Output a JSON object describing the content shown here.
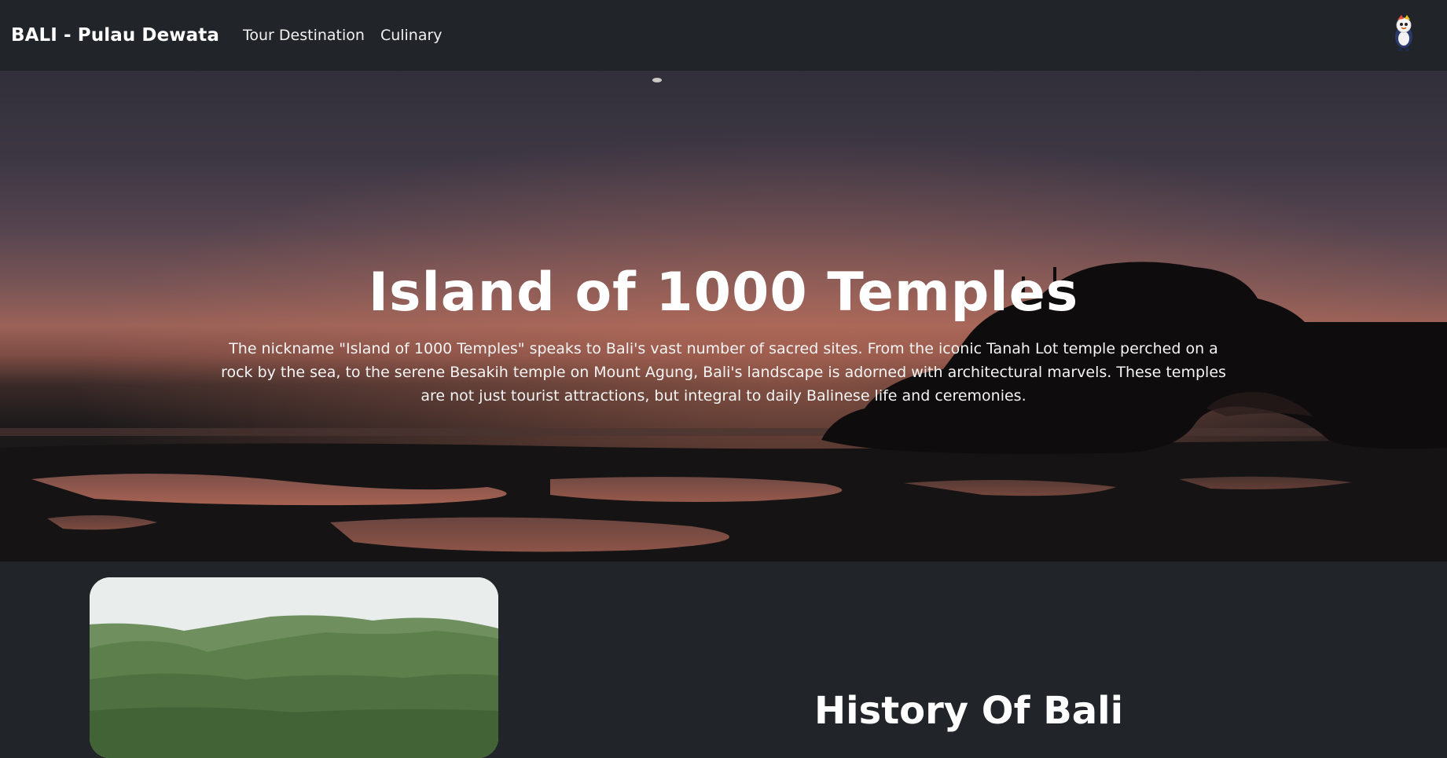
{
  "navbar": {
    "brand": "BALI - Pulau Dewata",
    "links": [
      "Tour Destination",
      "Culinary"
    ],
    "avatar_icon": "mascot-avatar-icon",
    "background": "#212529"
  },
  "hero": {
    "title": "Island of 1000 Temples",
    "description": "The nickname \"Island of 1000 Temples\" speaks to Bali's vast number of sacred sites. From the iconic Tanah Lot temple perched on a rock by the sea, to the serene Besakih temple on Mount Agung, Bali's landscape is adorned with architectural marvels. These temples are not just tourist attractions, but integral to daily Balinese life and ceremonies.",
    "background_image": "sunset-sea-temple-silhouette"
  },
  "history": {
    "title": "History Of Bali",
    "image": "forested-mountain-photo"
  }
}
